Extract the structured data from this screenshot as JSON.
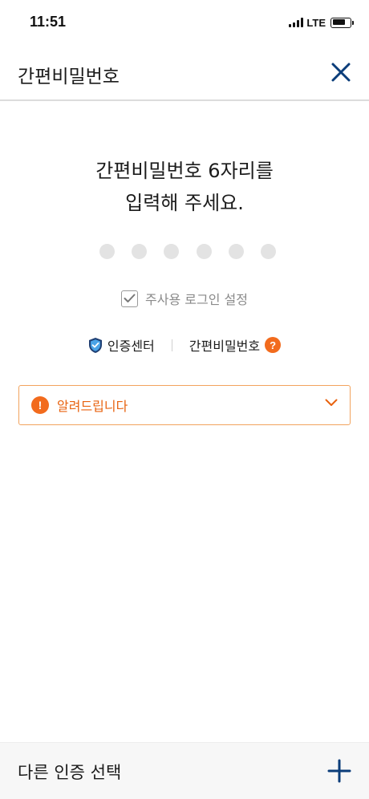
{
  "status_bar": {
    "time": "11:51",
    "network": "LTE",
    "icons": [
      "signal-icon",
      "battery-icon"
    ]
  },
  "header": {
    "title": "간편비밀번호",
    "close_icon": "close-icon"
  },
  "prompt": {
    "line1": "간편비밀번호 6자리를",
    "line2": "입력해 주세요."
  },
  "pin": {
    "length": 6,
    "entered": 0
  },
  "remember": {
    "label": "주사용 로그인 설정",
    "checked": true
  },
  "links": {
    "cert_center": "인증센터",
    "simple_pw": "간편비밀번호",
    "help_glyph": "?"
  },
  "notice": {
    "label": "알려드립니다",
    "alert_glyph": "!",
    "expanded": false
  },
  "footer": {
    "label": "다른 인증 선택",
    "icon": "plus-icon"
  },
  "colors": {
    "accent_orange": "#f26b1d",
    "navy": "#0b3d7a",
    "dot_empty": "#e3e3e3"
  }
}
